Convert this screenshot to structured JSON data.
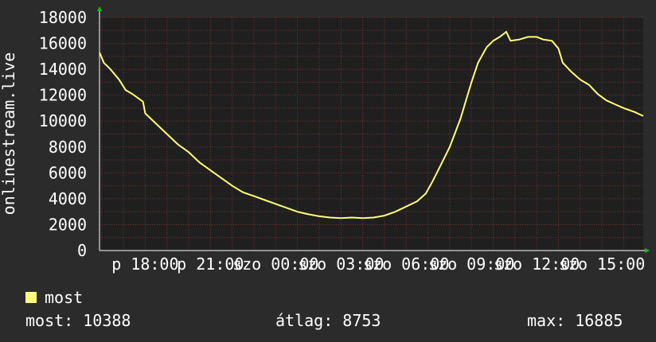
{
  "colors": {
    "background": "#2b2b2b",
    "plot_background": "#1f1f1f",
    "grid": "#7a3030",
    "series": "#ffff77",
    "axis_arrow": "#00cc00",
    "text": "#ffffff"
  },
  "chart_data": {
    "type": "line",
    "title": "",
    "ylabel": "onlinestream.live",
    "xlabel": "",
    "ylim": [
      0,
      18000
    ],
    "grid": true,
    "legend_placement": "bottom-left",
    "y_ticks": [
      "0",
      "2000",
      "4000",
      "6000",
      "8000",
      "10000",
      "12000",
      "14000",
      "16000",
      "18000"
    ],
    "x_ticks": [
      {
        "label": "p 18:00",
        "hour": 18
      },
      {
        "label": "p 21:00",
        "hour": 21
      },
      {
        "label": "szo 00:00",
        "hour": 24
      },
      {
        "label": "szo 03:00",
        "hour": 27
      },
      {
        "label": "szo 06:00",
        "hour": 30
      },
      {
        "label": "szo 09:00",
        "hour": 33
      },
      {
        "label": "szo 12:00",
        "hour": 36
      },
      {
        "label": "szo 15:00",
        "hour": 39
      }
    ],
    "series": [
      {
        "name": "most",
        "points": [
          [
            15.9,
            15300
          ],
          [
            16.1,
            14500
          ],
          [
            16.4,
            14000
          ],
          [
            16.8,
            13200
          ],
          [
            17.1,
            12400
          ],
          [
            17.4,
            12100
          ],
          [
            17.9,
            11500
          ],
          [
            18.0,
            10600
          ],
          [
            18.5,
            9800
          ],
          [
            19.0,
            9000
          ],
          [
            19.5,
            8200
          ],
          [
            20.0,
            7600
          ],
          [
            20.5,
            6800
          ],
          [
            21.0,
            6200
          ],
          [
            21.5,
            5600
          ],
          [
            22.0,
            5000
          ],
          [
            22.5,
            4500
          ],
          [
            23.0,
            4200
          ],
          [
            23.5,
            3900
          ],
          [
            24.0,
            3600
          ],
          [
            24.5,
            3300
          ],
          [
            25.0,
            3000
          ],
          [
            25.5,
            2800
          ],
          [
            26.0,
            2650
          ],
          [
            26.5,
            2550
          ],
          [
            27.0,
            2500
          ],
          [
            27.5,
            2550
          ],
          [
            28.0,
            2500
          ],
          [
            28.5,
            2550
          ],
          [
            29.0,
            2700
          ],
          [
            29.5,
            3000
          ],
          [
            30.0,
            3400
          ],
          [
            30.5,
            3800
          ],
          [
            30.9,
            4400
          ],
          [
            31.2,
            5300
          ],
          [
            31.5,
            6300
          ],
          [
            32.0,
            8000
          ],
          [
            32.5,
            10200
          ],
          [
            33.0,
            13000
          ],
          [
            33.3,
            14500
          ],
          [
            33.7,
            15700
          ],
          [
            34.0,
            16200
          ],
          [
            34.3,
            16500
          ],
          [
            34.6,
            16885
          ],
          [
            34.8,
            16200
          ],
          [
            35.2,
            16300
          ],
          [
            35.6,
            16500
          ],
          [
            36.0,
            16500
          ],
          [
            36.3,
            16300
          ],
          [
            36.7,
            16200
          ],
          [
            37.0,
            15600
          ],
          [
            37.2,
            14500
          ],
          [
            37.6,
            13800
          ],
          [
            38.0,
            13200
          ],
          [
            38.4,
            12800
          ],
          [
            38.8,
            12100
          ],
          [
            39.2,
            11600
          ],
          [
            39.6,
            11300
          ],
          [
            40.0,
            11000
          ],
          [
            40.5,
            10700
          ],
          [
            40.9,
            10388
          ]
        ]
      }
    ]
  },
  "legend": {
    "label": "most"
  },
  "stats": {
    "current": "most: 10388",
    "average": "átlag: 8753",
    "maximum": "max: 16885"
  }
}
